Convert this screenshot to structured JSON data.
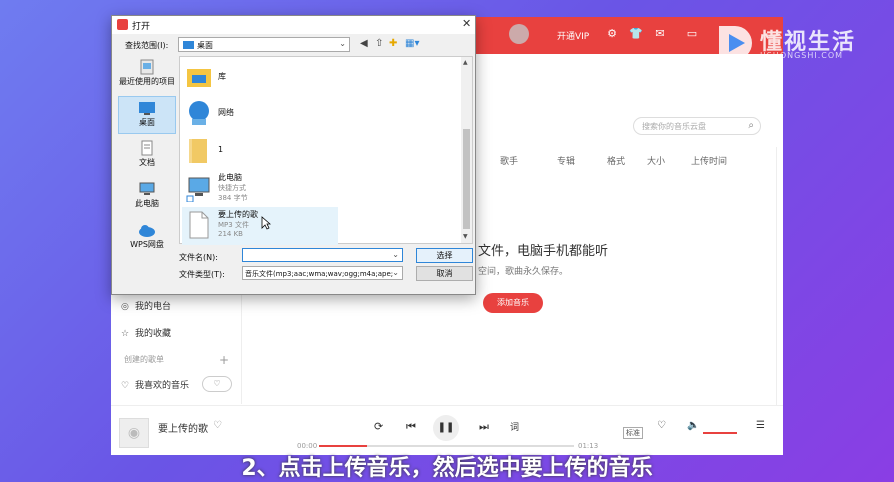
{
  "app": {
    "vip_label": "开通VIP",
    "search_placeholder": "搜索你的音乐云盘",
    "columns": [
      "歌手",
      "专辑",
      "格式",
      "大小",
      "上传时间"
    ],
    "empty_text": "文件，电脑手机都能听",
    "empty_sub": "空间，歌曲永久保存。",
    "add_button": "添加音乐",
    "sidebar": {
      "radio": "我的电台",
      "favorites": "我的收藏",
      "created_section": "创建的歌单",
      "liked": "我喜欢的音乐",
      "heart_mode": "♡"
    },
    "player": {
      "song": "要上传的歌",
      "time_current": "00:00",
      "time_total": "01:13",
      "lyric_tag": "标准",
      "lyric_btn": "词",
      "progress": 0.19
    },
    "accent": "#e8413f"
  },
  "dialog": {
    "title": "打开",
    "lookin_label": "查找范围(I):",
    "lookin_value": "桌面",
    "places": [
      {
        "label": "最近使用的项目"
      },
      {
        "label": "桌面"
      },
      {
        "label": "文档"
      },
      {
        "label": "此电脑"
      },
      {
        "label": "WPS网盘"
      }
    ],
    "files": [
      {
        "name": "库",
        "sub1": "",
        "sub2": ""
      },
      {
        "name": "网络",
        "sub1": "",
        "sub2": ""
      },
      {
        "name": "1",
        "sub1": "",
        "sub2": ""
      },
      {
        "name": "此电脑",
        "sub1": "快捷方式",
        "sub2": "384 字节"
      },
      {
        "name": "要上传的歌",
        "sub1": "MP3 文件",
        "sub2": "214 KB"
      }
    ],
    "filename_label": "文件名(N):",
    "filename_value": "",
    "filetype_label": "文件类型(T):",
    "filetype_value": "音乐文件(mp3;aac;wma;wav;ogg;m4a;ape;",
    "open_button": "选择",
    "cancel_button": "取消"
  },
  "watermark": {
    "text": "懂视生活",
    "sub": "JISHONGSHI.COM"
  },
  "caption": "2、点击上传音乐，然后选中要上传的音乐"
}
